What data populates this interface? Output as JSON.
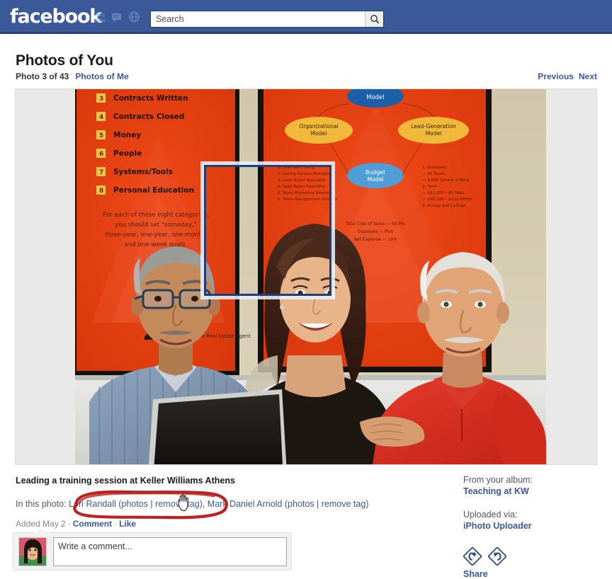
{
  "header": {
    "brand": "facebook",
    "icons": [
      "friends-icon",
      "messages-icon",
      "notifications-globe-icon"
    ],
    "search": {
      "placeholder": "Search",
      "value": "",
      "button_icon": "search-icon"
    },
    "colors": {
      "bar": "#3b5998",
      "bar_border": "#2c4372",
      "link": "#3b5998"
    }
  },
  "page": {
    "title": "Photos of You",
    "photo_count": "Photo 3 of 43",
    "photos_of_me_link": "Photos of Me",
    "nav": {
      "previous": "Previous",
      "next": "Next"
    }
  },
  "photo": {
    "caption": "Leading a training session at Keller Williams Athens",
    "tag_intro": "In this photo:",
    "tagged_people": [
      {
        "name": "Lori Randall",
        "photos_link": "photos",
        "remove_tag_link": "remove tag",
        "highlighted": true
      },
      {
        "name": "Mark Daniel Arnold",
        "photos_link": "photos",
        "remove_tag_link": "remove tag",
        "highlighted": false
      }
    ],
    "tag_box_label": "face-tag-box",
    "meta": {
      "added": "Added May 2",
      "comment_link": "Comment",
      "like_link": "Like",
      "separator": "·"
    },
    "scene": {
      "poster_left_items": [
        "Contracts Closed",
        "Money",
        "People",
        "Systems/Tools",
        "Personal Education"
      ],
      "poster_left_numbers": [
        "4",
        "5",
        "6",
        "7",
        "8"
      ],
      "poster_left_body": [
        "For each of these eight categories,",
        "you should set \"someday,\"",
        "three-year, one-year, one-month,",
        "and one-week goals."
      ],
      "poster_right_nodes": [
        "Model",
        "Organizational Model",
        "Lead-Generation Model",
        "Budget Model"
      ]
    }
  },
  "comment": {
    "placeholder": "Write a comment...",
    "value": "",
    "avatar_alt": "user-avatar"
  },
  "sidebar": {
    "album_label": "From your album:",
    "album_name": "Teaching at KW",
    "uploaded_label": "Uploaded via:",
    "uploaded_app": "iPhoto Uploader",
    "rotate_left_icon": "rotate-left-icon",
    "rotate_right_icon": "rotate-right-icon",
    "share_label": "Share"
  },
  "annotation": {
    "type": "hand-drawn-circle",
    "color": "#bb2222",
    "targets": "Lori Randall (photos | remove tag)",
    "cursor": "pointing-hand-cursor"
  }
}
